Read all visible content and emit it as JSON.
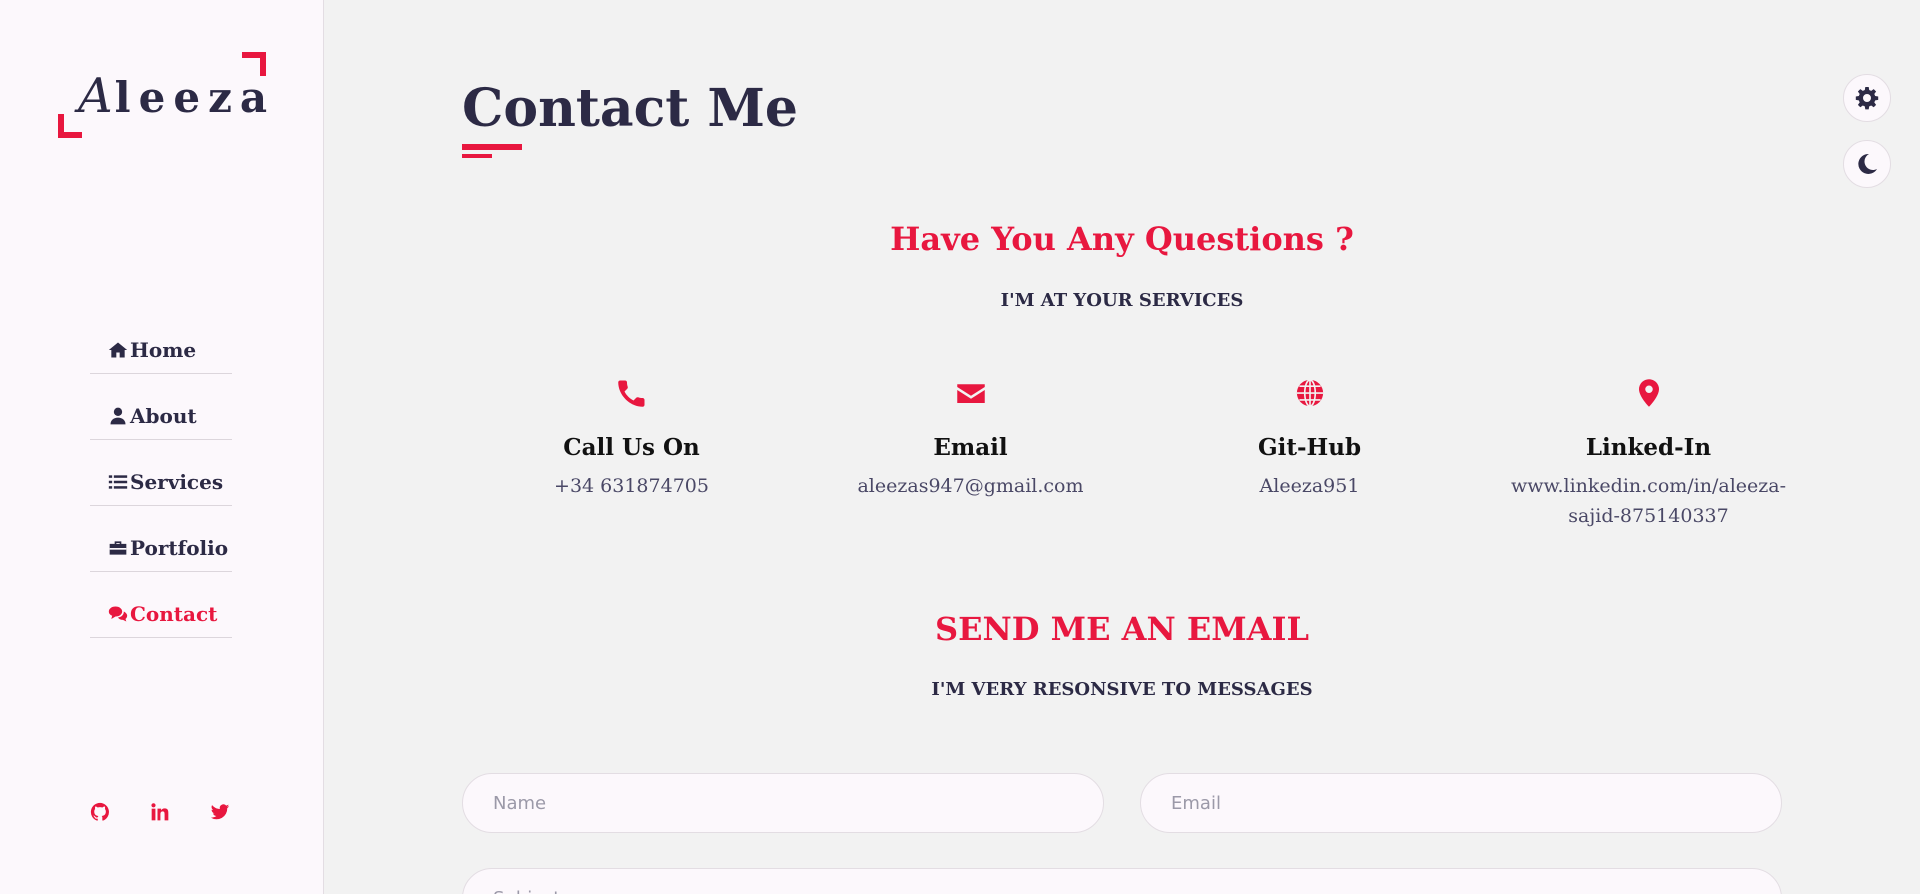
{
  "logo": {
    "first_letter": "A",
    "rest": "leeza"
  },
  "nav": [
    {
      "label": "Home",
      "icon": "home-icon"
    },
    {
      "label": "About",
      "icon": "user-icon"
    },
    {
      "label": "Services",
      "icon": "list-icon"
    },
    {
      "label": "Portfolio",
      "icon": "briefcase-icon"
    },
    {
      "label": "Contact",
      "icon": "comments-icon",
      "active": true
    }
  ],
  "socials": [
    "github-icon",
    "linkedin-icon",
    "twitter-icon"
  ],
  "page": {
    "title": "Contact Me"
  },
  "questions": {
    "heading": "Have You Any Questions ?",
    "subheading": "I'M AT YOUR SERVICES"
  },
  "contacts": [
    {
      "icon": "phone-icon",
      "label": "Call Us On",
      "value": "+34 631874705"
    },
    {
      "icon": "envelope-icon",
      "label": "Email",
      "value": "aleezas947@gmail.com"
    },
    {
      "icon": "globe-icon",
      "label": "Git-Hub",
      "value": "Aleeza951"
    },
    {
      "icon": "map-marker-icon",
      "label": "Linked-In",
      "value": "www.linkedin.com/in/aleeza-sajid-875140337"
    }
  ],
  "email_section": {
    "heading": "SEND ME AN EMAIL",
    "subheading": "I'M VERY RESONSIVE TO MESSAGES"
  },
  "form": {
    "name_placeholder": "Name",
    "email_placeholder": "Email",
    "subject_placeholder": "Subject"
  },
  "colors": {
    "accent": "#e8173f",
    "text": "#2c2a45",
    "sidebar_bg": "#fcf8fc",
    "main_bg": "#f2f2f2"
  }
}
